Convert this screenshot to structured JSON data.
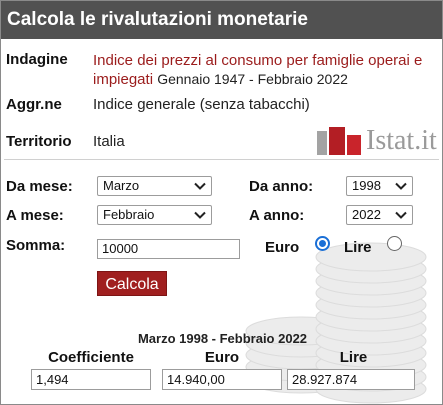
{
  "title": "Calcola le rivalutazioni monetarie",
  "info": {
    "indagine_label": "Indagine",
    "indagine_value": "Indice dei prezzi al consumo per famiglie operai e impiegati",
    "indagine_range": "Gennaio 1947 - Febbraio 2022",
    "aggr_label": "Aggr.ne",
    "aggr_value": "Indice generale (senza tabacchi)",
    "territorio_label": "Territorio",
    "territorio_value": "Italia",
    "logo_text": "Istat.it"
  },
  "form": {
    "da_mese_label": "Da mese:",
    "da_mese_value": "Marzo",
    "da_anno_label": "Da anno:",
    "da_anno_value": "1998",
    "a_mese_label": "A mese:",
    "a_mese_value": "Febbraio",
    "a_anno_label": "A anno:",
    "a_anno_value": "2022",
    "somma_label": "Somma:",
    "somma_value": "10000",
    "euro_label": "Euro",
    "lire_label": "Lire",
    "currency_selected": "Euro",
    "calcola_label": "Calcola"
  },
  "results": {
    "period": "Marzo 1998 - Febbraio 2022",
    "coeff_header": "Coefficiente",
    "euro_header": "Euro",
    "lire_header": "Lire",
    "coeff_value": "1,494",
    "euro_value": "14.940,00",
    "lire_value": "28.927.874"
  },
  "colors": {
    "titlebar": "#515151",
    "accent_red": "#a01f1f",
    "radio_blue": "#1a6fd6"
  }
}
